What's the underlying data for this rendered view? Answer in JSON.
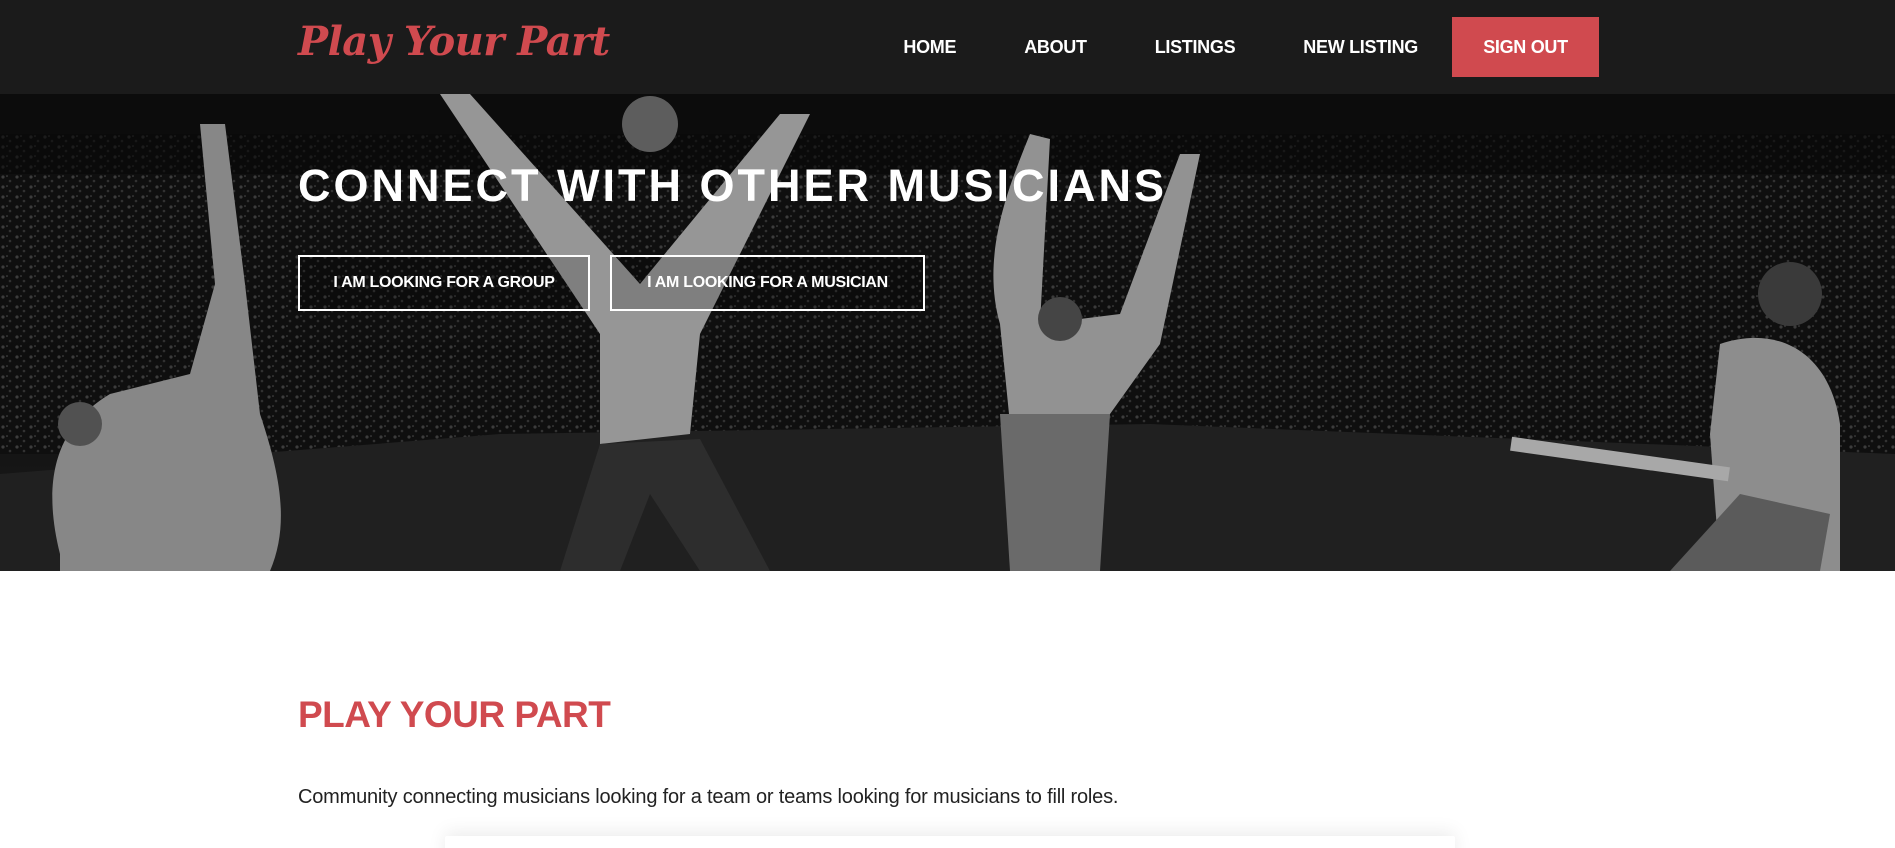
{
  "brand": {
    "name": "Play Your Part",
    "color": "#d04a4f"
  },
  "nav": {
    "items": [
      {
        "label": "HOME"
      },
      {
        "label": "ABOUT"
      },
      {
        "label": "LISTINGS"
      },
      {
        "label": "NEW LISTING"
      }
    ],
    "signout_label": "SIGN OUT"
  },
  "hero": {
    "title": "CONNECT WITH OTHER MUSICIANS",
    "buttons": {
      "group_label": "I AM LOOKING FOR A GROUP",
      "musician_label": "I AM LOOKING FOR A MUSICIAN"
    },
    "image": "black-and-white concert photo of band on stage facing crowd"
  },
  "intro": {
    "title": "PLAY YOUR PART",
    "description": "Community connecting musicians looking for a team or teams looking for musicians to fill roles."
  },
  "colors": {
    "accent": "#d04a4f",
    "navbar": "#1b1b1b",
    "text": "#222222"
  }
}
